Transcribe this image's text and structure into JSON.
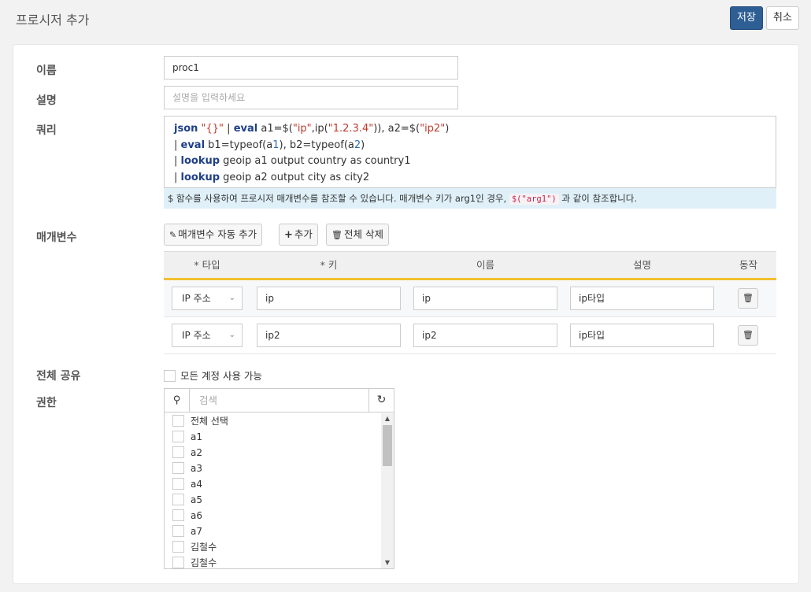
{
  "header": {
    "title": "프로시저 추가",
    "save_label": "저장",
    "cancel_label": "취소"
  },
  "form": {
    "name_label": "이름",
    "name_value": "proc1",
    "desc_label": "설명",
    "desc_placeholder": "설명을 입력하세요",
    "query_label": "쿼리",
    "query": {
      "line1": {
        "kw1": "json",
        "s1": "\"{}\"",
        "t1": " | ",
        "kw2": "eval",
        "t2": " a1=$(",
        "s2": "\"ip\"",
        "t3": ",ip(",
        "s3": "\"1.2.3.4\"",
        "t4": ")), a2=$(",
        "s4": "\"ip2\"",
        "t5": ")"
      },
      "line2": {
        "t1": "| ",
        "kw1": "eval",
        "t2": " b1=typeof(a",
        "n1": "1",
        "t3": "), b2=typeof(a",
        "n2": "2",
        "t4": ")"
      },
      "line3": {
        "t1": "| ",
        "kw1": "lookup",
        "t2": " geoip a1 output country as country1"
      },
      "line4": {
        "t1": "| ",
        "kw1": "lookup",
        "t2": " geoip a2 output city as city2"
      }
    },
    "hint_pre": "$ 함수를 사용하여 프로시저 매개변수를 참조할 수 있습니다. 매개변수 키가 arg1인 경우,",
    "hint_code": "$(\"arg1\")",
    "hint_post": "과 같이 참조합니다."
  },
  "params": {
    "label": "매개변수",
    "auto_add_label": "매개변수 자동 추가",
    "add_label": "추가",
    "delete_all_label": "전체 삭제",
    "columns": [
      "* 타입",
      "* 키",
      "이름",
      "설명",
      "동작"
    ],
    "rows": [
      {
        "type": "IP 주소",
        "key": "ip",
        "name": "ip",
        "desc": "ip타입"
      },
      {
        "type": "IP 주소",
        "key": "ip2",
        "name": "ip2",
        "desc": "ip타입"
      }
    ]
  },
  "share": {
    "label": "전체 공유",
    "checkbox_label": "모든 계정 사용 가능"
  },
  "permission": {
    "label": "권한",
    "search_placeholder": "검색",
    "items": [
      "전체 선택",
      "a1",
      "a2",
      "a3",
      "a4",
      "a5",
      "a6",
      "a7",
      "김철수",
      "김철수"
    ]
  }
}
